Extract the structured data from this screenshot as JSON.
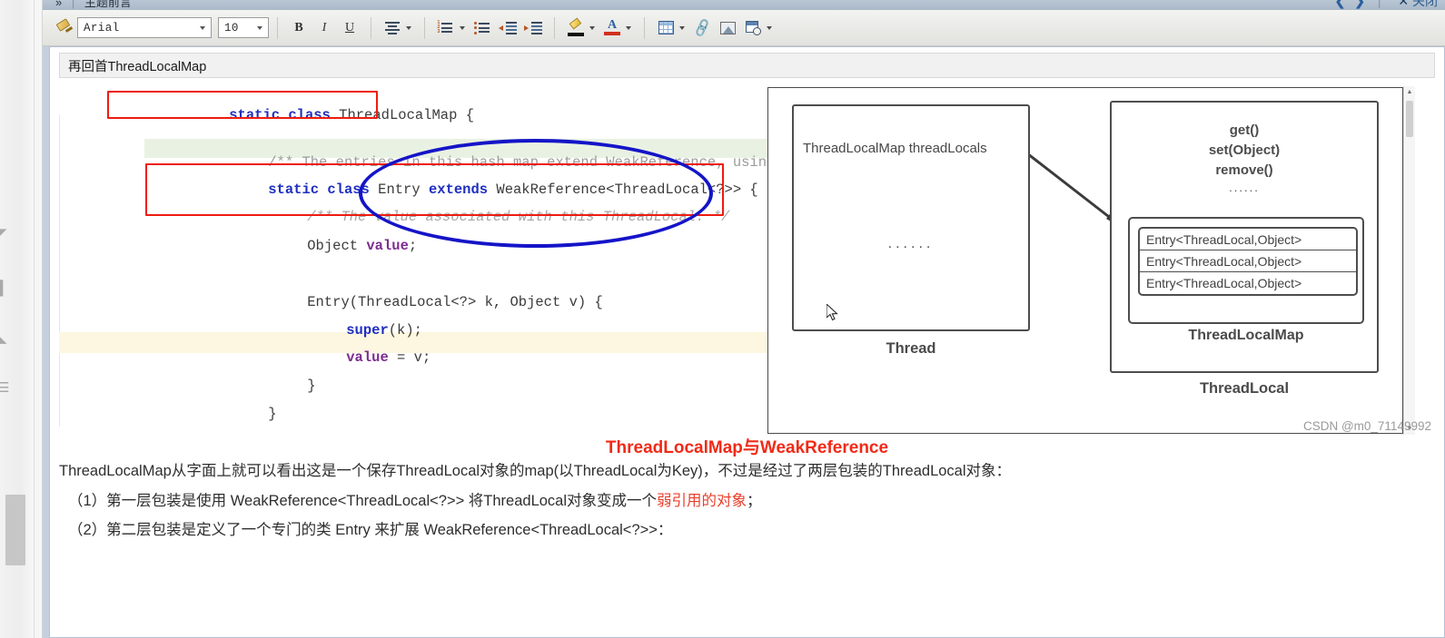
{
  "window": {
    "title": "主题前言",
    "left_chevron_icon": "chevron-left-icon",
    "right_chevron_icon": "chevron-right-icon",
    "close_label": "关闭"
  },
  "toolbar": {
    "format_painter": "format-painter",
    "font_name": "Arial",
    "font_size": "10",
    "bold": "B",
    "italic": "I",
    "underline": "U",
    "align": "align-icon",
    "numbered_list": "numbered-list-icon",
    "bullet_list": "bullet-list-icon",
    "decrease_indent": "decrease-indent-icon",
    "increase_indent": "increase-indent-icon",
    "highlight": "highlight-color-icon",
    "font_color": "font-color-icon",
    "table": "insert-table-icon",
    "link": "insert-link-icon",
    "image": "insert-image-icon",
    "screenshot": "insert-screenshot-icon"
  },
  "document": {
    "title": "再回首ThreadLocalMap"
  },
  "code": {
    "lines": [
      {
        "indent": 0,
        "parts": [
          {
            "t": "static class ",
            "c": "kw"
          },
          {
            "t": "ThreadLocalMap ",
            "c": "cls"
          },
          {
            "t": "{",
            "c": "cls"
          }
        ]
      },
      {
        "indent": 1,
        "parts": [
          {
            "t": "/** The entries in this hash map extend WeakReference, using ...*/",
            "c": "cmt"
          }
        ]
      },
      {
        "indent": 1,
        "parts": [
          {
            "t": "static class ",
            "c": "kw"
          },
          {
            "t": "Entry ",
            "c": "cls"
          },
          {
            "t": "extends ",
            "c": "kw"
          },
          {
            "t": "WeakReference<ThreadLocal<?>> {",
            "c": "cls"
          }
        ]
      },
      {
        "indent": 2,
        "parts": [
          {
            "t": "/** The value associated with this ThreadLocal. */",
            "c": "cmt-i"
          }
        ]
      },
      {
        "indent": 2,
        "parts": [
          {
            "t": "Object ",
            "c": "cls"
          },
          {
            "t": "value",
            "c": "fld"
          },
          {
            "t": ";",
            "c": "cls"
          }
        ]
      },
      {
        "indent": 0,
        "parts": []
      },
      {
        "indent": 2,
        "parts": [
          {
            "t": "Entry(ThreadLocal<?> k, Object v) {",
            "c": "cls"
          }
        ]
      },
      {
        "indent": 3,
        "parts": [
          {
            "t": "super",
            "c": "kw"
          },
          {
            "t": "(k);",
            "c": "cls"
          }
        ]
      },
      {
        "indent": 3,
        "parts": [
          {
            "t": "value",
            "c": "fld"
          },
          {
            "t": " = v;",
            "c": "cls"
          }
        ]
      },
      {
        "indent": 2,
        "parts": [
          {
            "t": "}",
            "c": "cls"
          }
        ]
      },
      {
        "indent": 1,
        "parts": [
          {
            "t": "}",
            "c": "cls"
          }
        ]
      }
    ],
    "annotations": {
      "red_box_1": "static class ThreadLocalMap",
      "red_box_2": "static class Entry extends WeakReference<ThreadLocal<?>>",
      "blue_ellipse": "WeakReference<ThreadLocal<?>>"
    }
  },
  "figure": {
    "thread": {
      "field_label": "ThreadLocalMap threadLocals",
      "dots": "......",
      "caption": "Thread"
    },
    "threadlocal": {
      "methods": [
        "get()",
        "set(Object)",
        "remove()"
      ],
      "dots": "......",
      "map_caption": "ThreadLocalMap",
      "entries": [
        "Entry<ThreadLocal,Object>",
        "Entry<ThreadLocal,Object>",
        "Entry<ThreadLocal,Object>"
      ],
      "caption": "ThreadLocal"
    },
    "scrollbar": {
      "up": "▲",
      "down": "▼"
    }
  },
  "caption": "ThreadLocalMap与WeakReference",
  "paragraphs": [
    {
      "segments": [
        {
          "t": "ThreadLocalMap从字面上就可以看出这是一个保存ThreadLocal对象的map(以ThreadLocal为Key)，不过是经过了两层包装的ThreadLocal对象：",
          "c": ""
        }
      ],
      "indent": false
    },
    {
      "segments": [
        {
          "t": "（1）第一层包装是使用 WeakReference<ThreadLocal<?>> 将ThreadLocal对象变成一个",
          "c": ""
        },
        {
          "t": "弱引用的对象",
          "c": "red"
        },
        {
          "t": "；",
          "c": ""
        }
      ],
      "indent": true
    },
    {
      "segments": [
        {
          "t": "（2）第二层包装是定义了一个专门的类 Entry 来扩展 WeakReference<ThreadLocal<?>>：",
          "c": ""
        }
      ],
      "indent": true
    }
  ],
  "watermark": "CSDN @m0_71149992",
  "colors": {
    "red_annotation": "#ee1c10",
    "blue_annotation": "#1414c8",
    "caption_red": "#f02a17",
    "code_keyword": "#1f2fbe",
    "code_field": "#7c2d8f",
    "highlight_green": "#e9f2e2",
    "highlight_cream": "#fdf6e0"
  }
}
